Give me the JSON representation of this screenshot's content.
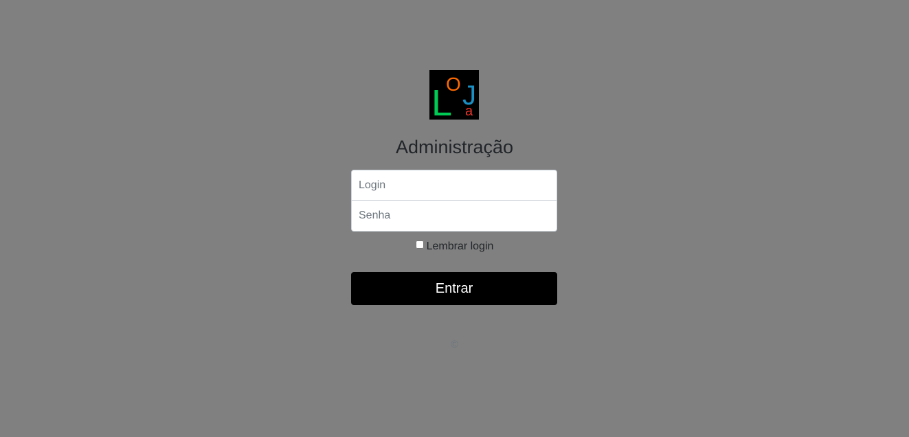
{
  "logo": {
    "letters": [
      "L",
      "O",
      "J",
      "a"
    ],
    "colors": {
      "L": "#00cc55",
      "O": "#ff6a00",
      "J": "#1a8fc4",
      "a": "#e8352a",
      "background": "#000000"
    }
  },
  "header": {
    "title": "Administração"
  },
  "form": {
    "login_placeholder": "Login",
    "password_placeholder": "Senha",
    "remember_label": "Lembrar login",
    "submit_label": "Entrar"
  },
  "footer": {
    "copyright": "©"
  },
  "theme": {
    "background": "#808080",
    "button_bg": "#000000",
    "button_text": "#ffffff"
  }
}
